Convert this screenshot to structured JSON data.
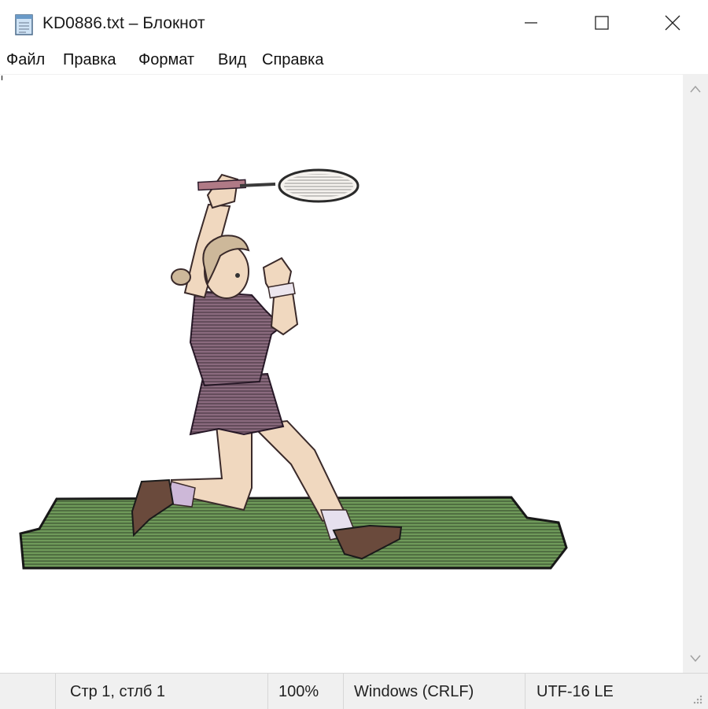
{
  "window": {
    "title": "KD0886.txt – Блокнот",
    "app_icon": "notepad-icon",
    "controls": {
      "minimize_icon": "minimize-icon",
      "maximize_icon": "maximize-icon",
      "close_icon": "close-icon"
    }
  },
  "menu": {
    "items": [
      {
        "label": "Файл"
      },
      {
        "label": "Правка"
      },
      {
        "label": "Формат"
      },
      {
        "label": "Вид"
      },
      {
        "label": "Справка"
      }
    ]
  },
  "editor": {
    "content_picture": "tennis-player-illustration",
    "colors": {
      "grass": "#6f9a5a",
      "dress": "#8a6a7e",
      "skin": "#f0d8bf",
      "shoes": "#6a4a3c"
    }
  },
  "scrollbar": {
    "up_icon": "scroll-up-icon",
    "down_icon": "scroll-down-icon"
  },
  "status": {
    "position": "Стр 1, стлб 1",
    "zoom": "100%",
    "line_endings": "Windows (CRLF)",
    "encoding": "UTF-16 LE"
  }
}
